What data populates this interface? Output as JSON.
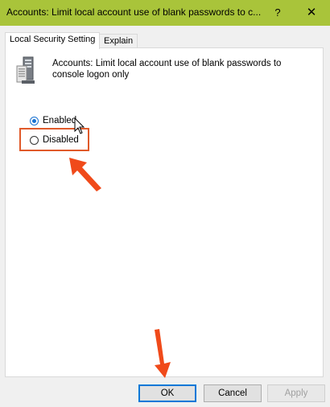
{
  "window": {
    "title": "Accounts: Limit local account use of blank passwords to c...",
    "help_glyph": "?",
    "close_glyph": "✕",
    "titlebar_color": "#a9c43a"
  },
  "tabs": [
    {
      "label": "Local Security Setting",
      "active": true
    },
    {
      "label": "Explain",
      "active": false
    }
  ],
  "policy": {
    "icon": "server-policy-icon",
    "description": "Accounts: Limit local account use of blank passwords to console logon only"
  },
  "options": [
    {
      "label": "Enabled",
      "selected": true
    },
    {
      "label": "Disabled",
      "selected": false
    }
  ],
  "buttons": {
    "ok": "OK",
    "cancel": "Cancel",
    "apply": "Apply"
  },
  "annotations": {
    "highlight_color": "#e05a2a",
    "arrow_color": "#f04a1a"
  }
}
